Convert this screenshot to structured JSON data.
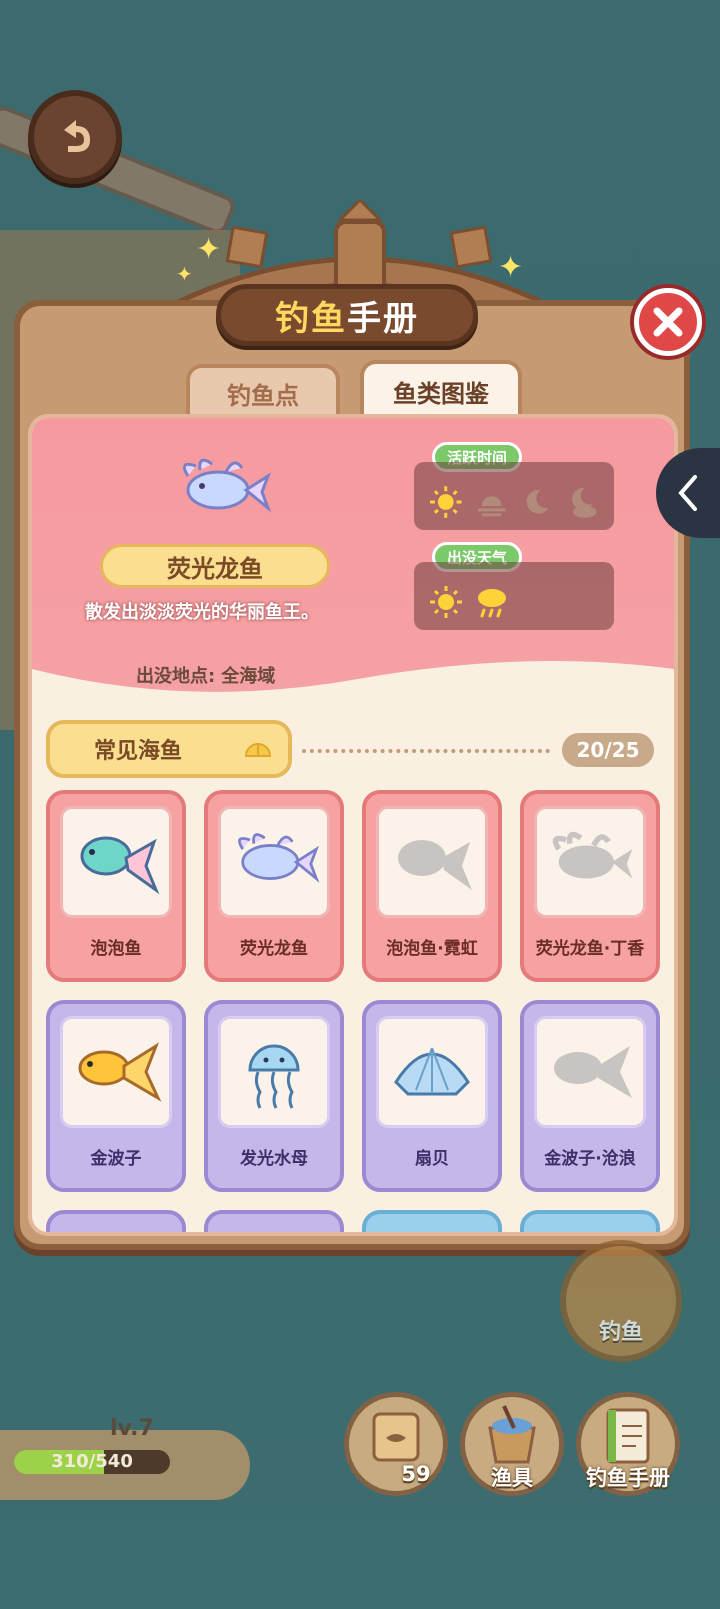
{
  "header": {
    "title_part1": "钓",
    "title_part2": "鱼",
    "title_part3": "手册"
  },
  "tabs": [
    {
      "label": "钓鱼点",
      "active": false
    },
    {
      "label": "鱼类图鉴",
      "active": true
    }
  ],
  "detail": {
    "name": "荧光龙鱼",
    "description": "散发出淡淡荧光的华丽鱼王。",
    "location_label": "出没地点:",
    "location_value": "全海域",
    "active_time_label": "活跃时间",
    "weather_label": "出没天气",
    "active_time_icons": [
      "sun-icon",
      "sunrise-icon",
      "moon-icon",
      "moon-cloud-icon"
    ],
    "weather_icons": [
      "sun-icon",
      "rain-cloud-icon"
    ]
  },
  "category": {
    "label": "常见海鱼",
    "count": "20/25"
  },
  "fish_cards": [
    {
      "label": "泡泡鱼",
      "theme": "pink",
      "unlocked": true
    },
    {
      "label": "荧光龙鱼",
      "theme": "pink",
      "unlocked": true
    },
    {
      "label": "泡泡鱼·霓虹",
      "theme": "pink",
      "unlocked": false
    },
    {
      "label": "荧光龙鱼·丁香",
      "theme": "pink",
      "unlocked": false
    },
    {
      "label": "金波子",
      "theme": "purple",
      "unlocked": true
    },
    {
      "label": "发光水母",
      "theme": "purple",
      "unlocked": true
    },
    {
      "label": "扇贝",
      "theme": "purple",
      "unlocked": true
    },
    {
      "label": "金波子·沧浪",
      "theme": "purple",
      "unlocked": false
    }
  ],
  "player": {
    "level": "lv.7",
    "xp_text": "310/540",
    "xp_progress": 0.574
  },
  "buttons": {
    "fishing": "钓鱼",
    "bait_count": "59",
    "gear": "渔具",
    "handbook": "钓鱼手册"
  },
  "colors": {
    "pink_card": "#f7a2a2",
    "purple_card": "#c6b7ea",
    "accent_red": "#e04848",
    "brown": "#8b5e3c"
  }
}
